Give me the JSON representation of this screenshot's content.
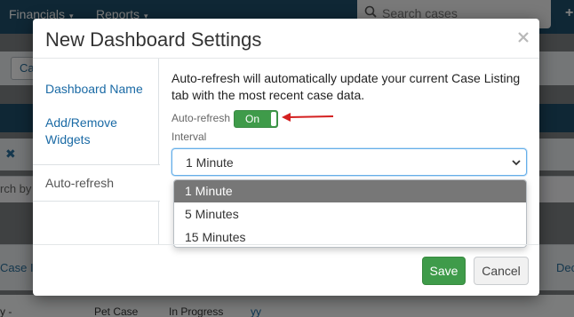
{
  "background": {
    "nav_links": [
      "Financials",
      "Reports"
    ],
    "search_placeholder": "Search cases",
    "plus_glyph": "+",
    "tab_fragment": "Ca",
    "remove_glyph": "✖",
    "search_fragment": "rch by",
    "column_case_id": "Case Id",
    "column_dec": "Dec",
    "row": {
      "col_a": "y -",
      "type": "Pet Case",
      "status": "In Progress",
      "link": "yy"
    }
  },
  "modal": {
    "title": "New Dashboard Settings",
    "close_glyph": "✕",
    "sidebar": {
      "items": [
        {
          "label": "Dashboard Name"
        },
        {
          "label": "Add/Remove Widgets"
        },
        {
          "label": "Auto-refresh"
        }
      ]
    },
    "content": {
      "description": "Auto-refresh will automatically update your current Case Listing tab with the most recent case data.",
      "toggle_label": "Auto-refresh",
      "toggle_state": "On",
      "interval_label": "Interval",
      "interval_value": "1 Minute",
      "interval_options": [
        "1 Minute",
        "5 Minutes",
        "15 Minutes"
      ]
    },
    "footer": {
      "save_label": "Save",
      "cancel_label": "Cancel"
    }
  },
  "colors": {
    "nav_bg": "#1f4e6a",
    "toggle_on": "#3f9b4a",
    "save_button": "#3f9b4a",
    "link": "#1a6aa5",
    "selected_option": "#777777",
    "annotation_arrow": "#d42020"
  }
}
